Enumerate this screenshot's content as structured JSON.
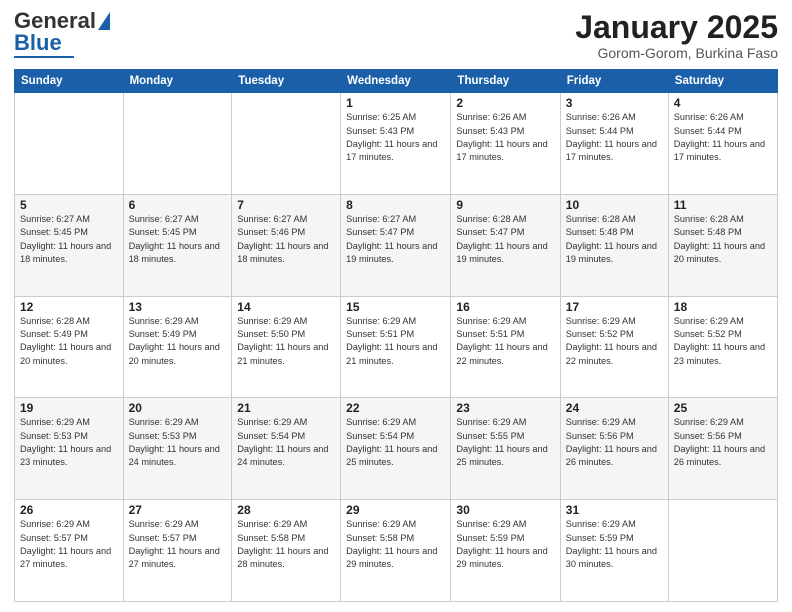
{
  "logo": {
    "line1": "General",
    "line2": "Blue"
  },
  "header": {
    "title": "January 2025",
    "subtitle": "Gorom-Gorom, Burkina Faso"
  },
  "weekdays": [
    "Sunday",
    "Monday",
    "Tuesday",
    "Wednesday",
    "Thursday",
    "Friday",
    "Saturday"
  ],
  "weeks": [
    [
      {
        "day": "",
        "info": ""
      },
      {
        "day": "",
        "info": ""
      },
      {
        "day": "",
        "info": ""
      },
      {
        "day": "1",
        "info": "Sunrise: 6:25 AM\nSunset: 5:43 PM\nDaylight: 11 hours and 17 minutes."
      },
      {
        "day": "2",
        "info": "Sunrise: 6:26 AM\nSunset: 5:43 PM\nDaylight: 11 hours and 17 minutes."
      },
      {
        "day": "3",
        "info": "Sunrise: 6:26 AM\nSunset: 5:44 PM\nDaylight: 11 hours and 17 minutes."
      },
      {
        "day": "4",
        "info": "Sunrise: 6:26 AM\nSunset: 5:44 PM\nDaylight: 11 hours and 17 minutes."
      }
    ],
    [
      {
        "day": "5",
        "info": "Sunrise: 6:27 AM\nSunset: 5:45 PM\nDaylight: 11 hours and 18 minutes."
      },
      {
        "day": "6",
        "info": "Sunrise: 6:27 AM\nSunset: 5:45 PM\nDaylight: 11 hours and 18 minutes."
      },
      {
        "day": "7",
        "info": "Sunrise: 6:27 AM\nSunset: 5:46 PM\nDaylight: 11 hours and 18 minutes."
      },
      {
        "day": "8",
        "info": "Sunrise: 6:27 AM\nSunset: 5:47 PM\nDaylight: 11 hours and 19 minutes."
      },
      {
        "day": "9",
        "info": "Sunrise: 6:28 AM\nSunset: 5:47 PM\nDaylight: 11 hours and 19 minutes."
      },
      {
        "day": "10",
        "info": "Sunrise: 6:28 AM\nSunset: 5:48 PM\nDaylight: 11 hours and 19 minutes."
      },
      {
        "day": "11",
        "info": "Sunrise: 6:28 AM\nSunset: 5:48 PM\nDaylight: 11 hours and 20 minutes."
      }
    ],
    [
      {
        "day": "12",
        "info": "Sunrise: 6:28 AM\nSunset: 5:49 PM\nDaylight: 11 hours and 20 minutes."
      },
      {
        "day": "13",
        "info": "Sunrise: 6:29 AM\nSunset: 5:49 PM\nDaylight: 11 hours and 20 minutes."
      },
      {
        "day": "14",
        "info": "Sunrise: 6:29 AM\nSunset: 5:50 PM\nDaylight: 11 hours and 21 minutes."
      },
      {
        "day": "15",
        "info": "Sunrise: 6:29 AM\nSunset: 5:51 PM\nDaylight: 11 hours and 21 minutes."
      },
      {
        "day": "16",
        "info": "Sunrise: 6:29 AM\nSunset: 5:51 PM\nDaylight: 11 hours and 22 minutes."
      },
      {
        "day": "17",
        "info": "Sunrise: 6:29 AM\nSunset: 5:52 PM\nDaylight: 11 hours and 22 minutes."
      },
      {
        "day": "18",
        "info": "Sunrise: 6:29 AM\nSunset: 5:52 PM\nDaylight: 11 hours and 23 minutes."
      }
    ],
    [
      {
        "day": "19",
        "info": "Sunrise: 6:29 AM\nSunset: 5:53 PM\nDaylight: 11 hours and 23 minutes."
      },
      {
        "day": "20",
        "info": "Sunrise: 6:29 AM\nSunset: 5:53 PM\nDaylight: 11 hours and 24 minutes."
      },
      {
        "day": "21",
        "info": "Sunrise: 6:29 AM\nSunset: 5:54 PM\nDaylight: 11 hours and 24 minutes."
      },
      {
        "day": "22",
        "info": "Sunrise: 6:29 AM\nSunset: 5:54 PM\nDaylight: 11 hours and 25 minutes."
      },
      {
        "day": "23",
        "info": "Sunrise: 6:29 AM\nSunset: 5:55 PM\nDaylight: 11 hours and 25 minutes."
      },
      {
        "day": "24",
        "info": "Sunrise: 6:29 AM\nSunset: 5:56 PM\nDaylight: 11 hours and 26 minutes."
      },
      {
        "day": "25",
        "info": "Sunrise: 6:29 AM\nSunset: 5:56 PM\nDaylight: 11 hours and 26 minutes."
      }
    ],
    [
      {
        "day": "26",
        "info": "Sunrise: 6:29 AM\nSunset: 5:57 PM\nDaylight: 11 hours and 27 minutes."
      },
      {
        "day": "27",
        "info": "Sunrise: 6:29 AM\nSunset: 5:57 PM\nDaylight: 11 hours and 27 minutes."
      },
      {
        "day": "28",
        "info": "Sunrise: 6:29 AM\nSunset: 5:58 PM\nDaylight: 11 hours and 28 minutes."
      },
      {
        "day": "29",
        "info": "Sunrise: 6:29 AM\nSunset: 5:58 PM\nDaylight: 11 hours and 29 minutes."
      },
      {
        "day": "30",
        "info": "Sunrise: 6:29 AM\nSunset: 5:59 PM\nDaylight: 11 hours and 29 minutes."
      },
      {
        "day": "31",
        "info": "Sunrise: 6:29 AM\nSunset: 5:59 PM\nDaylight: 11 hours and 30 minutes."
      },
      {
        "day": "",
        "info": ""
      }
    ]
  ]
}
